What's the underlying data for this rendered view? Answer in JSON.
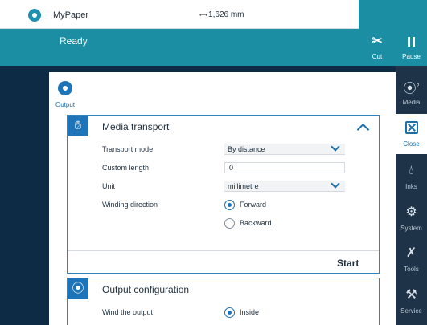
{
  "header": {
    "media_name": "MyPaper",
    "media_length": "1,626 mm",
    "status": "Ready"
  },
  "actions": {
    "cut_label": "Cut",
    "pause_label": "Pause"
  },
  "rail": {
    "media_label": "Media",
    "media_count": "2",
    "close_label": "Close",
    "inks_label": "Inks",
    "system_label": "System",
    "tools_label": "Tools",
    "service_label": "Service"
  },
  "panel": {
    "section_label": "Output"
  },
  "media_transport": {
    "title": "Media transport",
    "transport_mode_label": "Transport mode",
    "transport_mode_value": "By distance",
    "custom_length_label": "Custom length",
    "custom_length_value": "0",
    "unit_label": "Unit",
    "unit_value": "millimetre",
    "winding_direction_label": "Winding direction",
    "winding_options": [
      "Forward",
      "Backward"
    ],
    "winding_selected": "Forward",
    "start_label": "Start"
  },
  "output_configuration": {
    "title": "Output configuration",
    "wind_output_label": "Wind the output",
    "wind_options": [
      "Inside"
    ],
    "wind_selected": "Inside"
  },
  "colors": {
    "accent": "#1c8ea4",
    "primary": "#1e74b8",
    "rail_bg": "#1e3348",
    "page_bg": "#0e2b45"
  }
}
